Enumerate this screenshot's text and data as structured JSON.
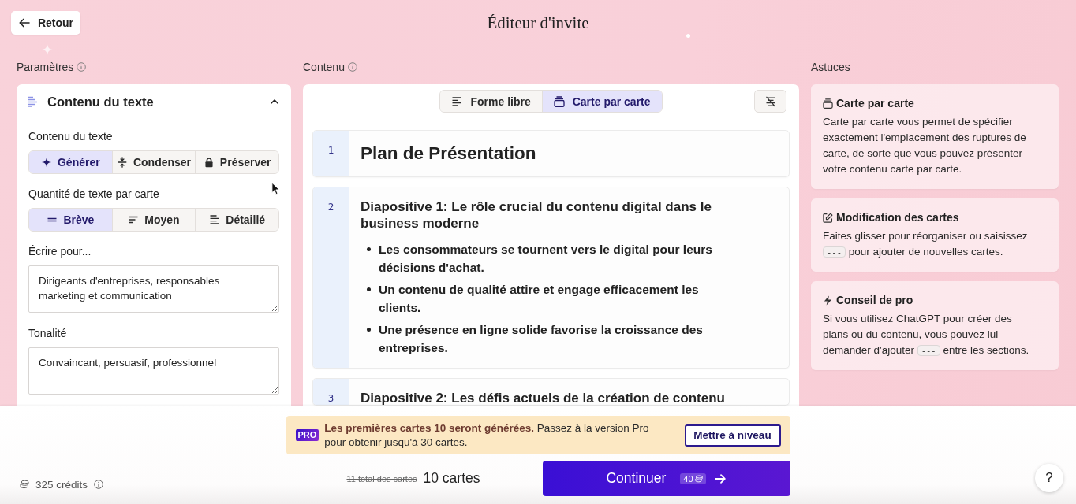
{
  "header": {
    "back_button": "Retour",
    "title": "Éditeur d'invite"
  },
  "settings": {
    "label": "Paramètres",
    "panel": {
      "title": "Contenu du texte",
      "expanded": true,
      "text_content": {
        "label": "Contenu du texte",
        "options": [
          {
            "label": "Générer",
            "selected": true
          },
          {
            "label": "Condenser",
            "selected": false
          },
          {
            "label": "Préserver",
            "selected": false
          }
        ]
      },
      "text_amount": {
        "label": "Quantité de texte par carte",
        "options": [
          {
            "label": "Brève",
            "selected": true
          },
          {
            "label": "Moyen",
            "selected": false
          },
          {
            "label": "Détaillé",
            "selected": false
          }
        ]
      },
      "audience": {
        "label": "Écrire pour...",
        "value": "Dirigeants d'entreprises, responsables marketing et communication"
      },
      "tone": {
        "label": "Tonalité",
        "value": "Convaincant, persuasif, professionnel"
      }
    }
  },
  "content": {
    "label": "Contenu",
    "modes": [
      {
        "label": "Forme libre",
        "selected": false
      },
      {
        "label": "Carte par carte",
        "selected": true
      }
    ],
    "cards": [
      {
        "kind": "title",
        "number": "1",
        "heading": "Plan de Présentation"
      },
      {
        "kind": "slide",
        "number": "2",
        "heading": "Diapositive 1: Le rôle crucial du contenu digital dans le business moderne",
        "bullets": [
          "Les consommateurs se tournent vers le digital pour leurs décisions d'achat.",
          "Un contenu de qualité attire et engage efficacement les clients.",
          "Une présence en ligne solide favorise la croissance des entreprises."
        ]
      },
      {
        "kind": "slide",
        "number": "3",
        "heading": "Diapositive 2: Les défis actuels de la création de contenu"
      }
    ]
  },
  "tips": {
    "label": "Astuces",
    "items": [
      {
        "title": "Carte par carte",
        "parts": [
          {
            "kind": "text",
            "text": "Carte par carte vous permet de spécifier exactement l'emplacement des ruptures de carte, de sorte que vous pouvez présenter votre contenu carte par carte."
          }
        ]
      },
      {
        "title": "Modification des cartes",
        "parts": [
          {
            "kind": "text",
            "text": "Faites glisser pour réorganiser ou saisissez "
          },
          {
            "kind": "code",
            "text": "---"
          },
          {
            "kind": "text",
            "text": " pour ajouter de nouvelles cartes."
          }
        ]
      },
      {
        "title": "Conseil de pro",
        "parts": [
          {
            "kind": "text",
            "text": "Si vous utilisez ChatGPT pour créer des plans ou du contenu, vous pouvez lui demander d'ajouter "
          },
          {
            "kind": "code",
            "text": "---"
          },
          {
            "kind": "text",
            "text": " entre les sections."
          }
        ]
      }
    ]
  },
  "footer": {
    "credits": "325 crédits",
    "banner": {
      "badge": "PRO",
      "message": "**Les premières cartes 10 seront générées.** Passez à la version Pro pour obtenir jusqu'à 30 cartes.",
      "button": "Mettre à niveau"
    },
    "previous_total": "11 total des cartes",
    "total": "10 cartes",
    "continue_button": {
      "label": "Continuer",
      "cost": "40"
    },
    "help_button": "?"
  }
}
